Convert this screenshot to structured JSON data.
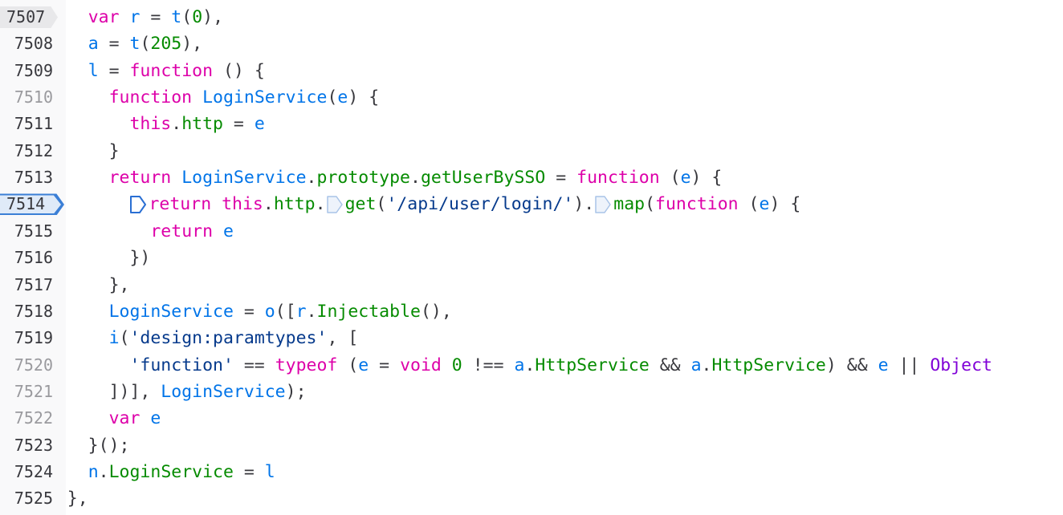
{
  "editor": {
    "lines": [
      {
        "number": "7507",
        "state": "paused",
        "tokens": [
          {
            "t": "  ",
            "c": "p"
          },
          {
            "t": "var",
            "c": "kw"
          },
          {
            "t": " ",
            "c": "p"
          },
          {
            "t": "r",
            "c": "id"
          },
          {
            "t": " = ",
            "c": "p"
          },
          {
            "t": "t",
            "c": "id"
          },
          {
            "t": "(",
            "c": "p"
          },
          {
            "t": "0",
            "c": "num-lit"
          },
          {
            "t": "),",
            "c": "p"
          }
        ]
      },
      {
        "number": "7508",
        "state": "normal",
        "tokens": [
          {
            "t": "  ",
            "c": "p"
          },
          {
            "t": "a",
            "c": "id"
          },
          {
            "t": " = ",
            "c": "p"
          },
          {
            "t": "t",
            "c": "id"
          },
          {
            "t": "(",
            "c": "p"
          },
          {
            "t": "205",
            "c": "num-lit"
          },
          {
            "t": "),",
            "c": "p"
          }
        ]
      },
      {
        "number": "7509",
        "state": "normal",
        "tokens": [
          {
            "t": "  ",
            "c": "p"
          },
          {
            "t": "l",
            "c": "id"
          },
          {
            "t": " = ",
            "c": "p"
          },
          {
            "t": "function",
            "c": "kw"
          },
          {
            "t": " () {",
            "c": "p"
          }
        ]
      },
      {
        "number": "7510",
        "state": "dim",
        "tokens": [
          {
            "t": "    ",
            "c": "p"
          },
          {
            "t": "function",
            "c": "kw"
          },
          {
            "t": " ",
            "c": "p"
          },
          {
            "t": "LoginService",
            "c": "fn"
          },
          {
            "t": "(",
            "c": "p"
          },
          {
            "t": "e",
            "c": "id"
          },
          {
            "t": ") {",
            "c": "p"
          }
        ]
      },
      {
        "number": "7511",
        "state": "normal",
        "tokens": [
          {
            "t": "      ",
            "c": "p"
          },
          {
            "t": "this",
            "c": "kw"
          },
          {
            "t": ".",
            "c": "p"
          },
          {
            "t": "http",
            "c": "prop"
          },
          {
            "t": " = ",
            "c": "p"
          },
          {
            "t": "e",
            "c": "id"
          }
        ]
      },
      {
        "number": "7512",
        "state": "normal",
        "tokens": [
          {
            "t": "    }",
            "c": "p"
          }
        ]
      },
      {
        "number": "7513",
        "state": "normal",
        "tokens": [
          {
            "t": "    ",
            "c": "p"
          },
          {
            "t": "return",
            "c": "kw"
          },
          {
            "t": " ",
            "c": "p"
          },
          {
            "t": "LoginService",
            "c": "fn"
          },
          {
            "t": ".",
            "c": "p"
          },
          {
            "t": "prototype",
            "c": "prop"
          },
          {
            "t": ".",
            "c": "p"
          },
          {
            "t": "getUserBySSO",
            "c": "prop"
          },
          {
            "t": " = ",
            "c": "p"
          },
          {
            "t": "function",
            "c": "kw"
          },
          {
            "t": " (",
            "c": "p"
          },
          {
            "t": "e",
            "c": "id"
          },
          {
            "t": ") {",
            "c": "p"
          }
        ]
      },
      {
        "number": "7514",
        "state": "current",
        "tokens": [
          {
            "t": "      ",
            "c": "p"
          },
          {
            "bp": "active"
          },
          {
            "t": "return",
            "c": "kw"
          },
          {
            "t": " ",
            "c": "p"
          },
          {
            "t": "this",
            "c": "kw"
          },
          {
            "t": ".",
            "c": "p"
          },
          {
            "t": "http",
            "c": "prop"
          },
          {
            "t": ".",
            "c": "p"
          },
          {
            "bp": "inactive"
          },
          {
            "t": "get",
            "c": "prop"
          },
          {
            "t": "(",
            "c": "p"
          },
          {
            "t": "'/api/user/login/'",
            "c": "str"
          },
          {
            "t": ").",
            "c": "p"
          },
          {
            "bp": "inactive"
          },
          {
            "t": "map",
            "c": "prop"
          },
          {
            "t": "(",
            "c": "p"
          },
          {
            "t": "function",
            "c": "kw"
          },
          {
            "t": " (",
            "c": "p"
          },
          {
            "t": "e",
            "c": "id"
          },
          {
            "t": ") {",
            "c": "p"
          }
        ]
      },
      {
        "number": "7515",
        "state": "normal",
        "tokens": [
          {
            "t": "        ",
            "c": "p"
          },
          {
            "t": "return",
            "c": "kw"
          },
          {
            "t": " ",
            "c": "p"
          },
          {
            "t": "e",
            "c": "id"
          }
        ]
      },
      {
        "number": "7516",
        "state": "normal",
        "tokens": [
          {
            "t": "      })",
            "c": "p"
          }
        ]
      },
      {
        "number": "7517",
        "state": "normal",
        "tokens": [
          {
            "t": "    },",
            "c": "p"
          }
        ]
      },
      {
        "number": "7518",
        "state": "normal",
        "tokens": [
          {
            "t": "    ",
            "c": "p"
          },
          {
            "t": "LoginService",
            "c": "fn"
          },
          {
            "t": " = ",
            "c": "p"
          },
          {
            "t": "o",
            "c": "id"
          },
          {
            "t": "([",
            "c": "p"
          },
          {
            "t": "r",
            "c": "id"
          },
          {
            "t": ".",
            "c": "p"
          },
          {
            "t": "Injectable",
            "c": "prop"
          },
          {
            "t": "(),",
            "c": "p"
          }
        ]
      },
      {
        "number": "7519",
        "state": "normal",
        "tokens": [
          {
            "t": "    ",
            "c": "p"
          },
          {
            "t": "i",
            "c": "id"
          },
          {
            "t": "(",
            "c": "p"
          },
          {
            "t": "'design:paramtypes'",
            "c": "str"
          },
          {
            "t": ", [",
            "c": "p"
          }
        ]
      },
      {
        "number": "7520",
        "state": "dim",
        "tokens": [
          {
            "t": "      ",
            "c": "p"
          },
          {
            "t": "'function'",
            "c": "str"
          },
          {
            "t": " == ",
            "c": "p"
          },
          {
            "t": "typeof",
            "c": "kw"
          },
          {
            "t": " (",
            "c": "p"
          },
          {
            "t": "e",
            "c": "id"
          },
          {
            "t": " = ",
            "c": "p"
          },
          {
            "t": "void",
            "c": "kw"
          },
          {
            "t": " ",
            "c": "p"
          },
          {
            "t": "0",
            "c": "num-lit"
          },
          {
            "t": " !== ",
            "c": "p"
          },
          {
            "t": "a",
            "c": "id"
          },
          {
            "t": ".",
            "c": "p"
          },
          {
            "t": "HttpService",
            "c": "prop"
          },
          {
            "t": " && ",
            "c": "p"
          },
          {
            "t": "a",
            "c": "id"
          },
          {
            "t": ".",
            "c": "p"
          },
          {
            "t": "HttpService",
            "c": "prop"
          },
          {
            "t": ") && ",
            "c": "p"
          },
          {
            "t": "e",
            "c": "id"
          },
          {
            "t": " || ",
            "c": "p"
          },
          {
            "t": "Object",
            "c": "obj"
          }
        ]
      },
      {
        "number": "7521",
        "state": "dim",
        "tokens": [
          {
            "t": "    ])], ",
            "c": "p"
          },
          {
            "t": "LoginService",
            "c": "fn"
          },
          {
            "t": ");",
            "c": "p"
          }
        ]
      },
      {
        "number": "7522",
        "state": "dim",
        "tokens": [
          {
            "t": "    ",
            "c": "p"
          },
          {
            "t": "var",
            "c": "kw"
          },
          {
            "t": " ",
            "c": "p"
          },
          {
            "t": "e",
            "c": "id"
          }
        ]
      },
      {
        "number": "7523",
        "state": "normal",
        "tokens": [
          {
            "t": "  }();",
            "c": "p"
          }
        ]
      },
      {
        "number": "7524",
        "state": "normal",
        "tokens": [
          {
            "t": "  ",
            "c": "p"
          },
          {
            "t": "n",
            "c": "id"
          },
          {
            "t": ".",
            "c": "p"
          },
          {
            "t": "LoginService",
            "c": "prop"
          },
          {
            "t": " = ",
            "c": "p"
          },
          {
            "t": "l",
            "c": "id"
          }
        ]
      },
      {
        "number": "7525",
        "state": "normal",
        "tokens": [
          {
            "t": "},",
            "c": "p"
          }
        ]
      }
    ]
  }
}
